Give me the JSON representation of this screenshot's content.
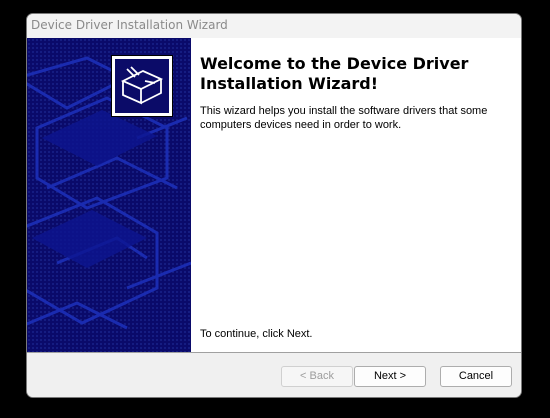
{
  "window": {
    "title": "Device Driver Installation Wizard"
  },
  "welcome": {
    "heading": "Welcome to the Device Driver Installation Wizard!",
    "description": "This wizard helps you install the software drivers that some computers devices need in order to work.",
    "continue_text": "To continue, click Next."
  },
  "banner": {
    "icon": "install-box-icon",
    "background_color": "#0a0a6a"
  },
  "buttons": {
    "back_label": "< Back",
    "next_label": "Next >",
    "cancel_label": "Cancel"
  }
}
